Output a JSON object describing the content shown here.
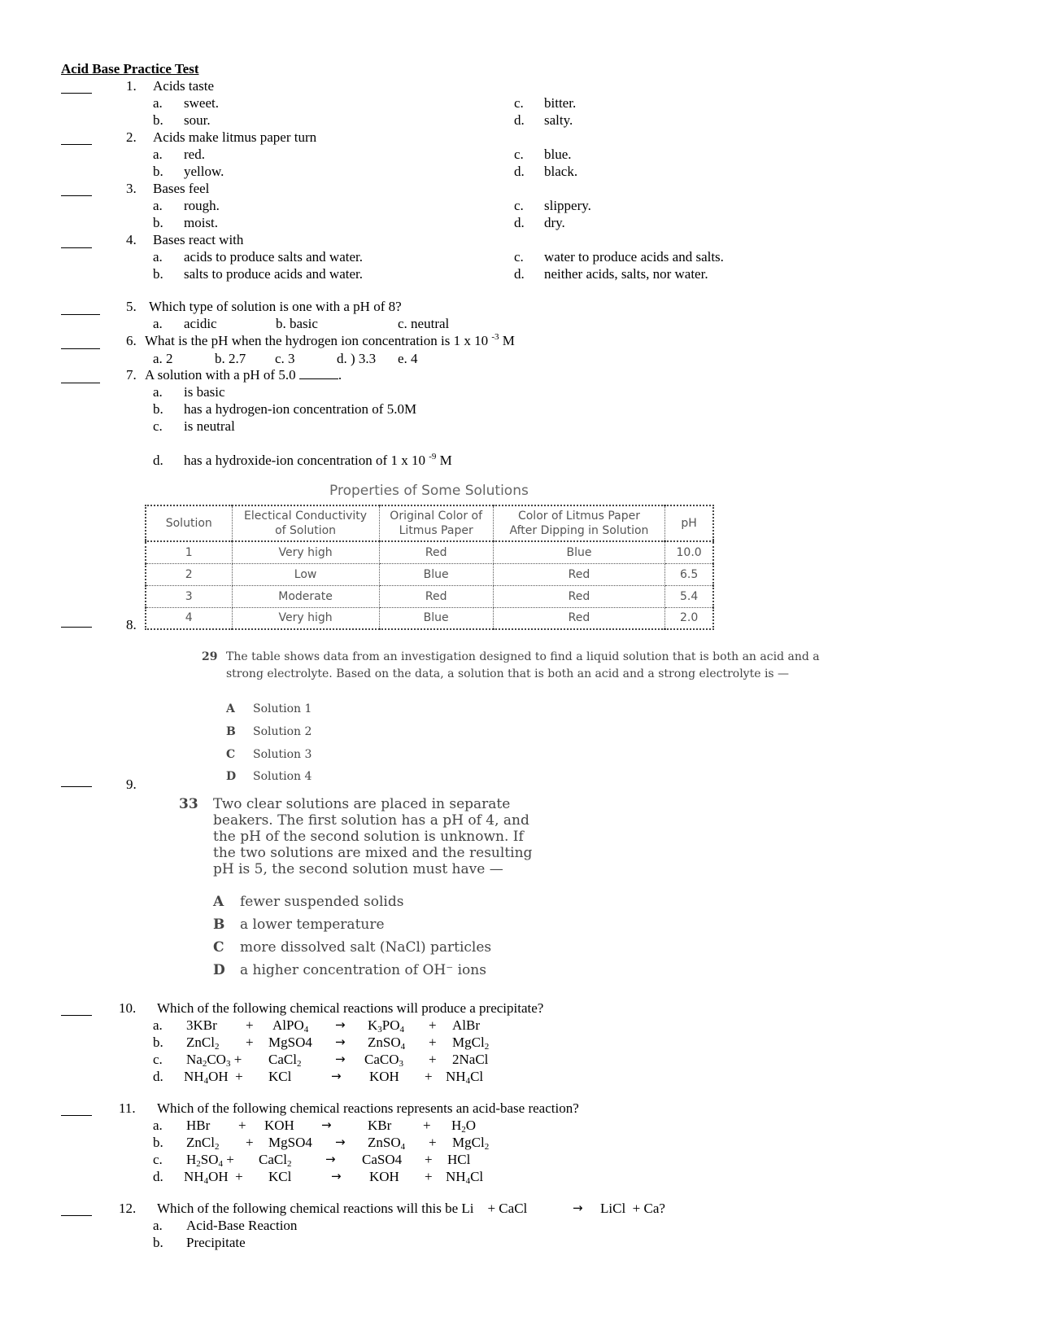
{
  "title": "Acid Base Practice Test",
  "q1": {
    "num": "1.",
    "text": "Acids taste",
    "a": "a.",
    "a_t": "sweet.",
    "b": "b.",
    "b_t": "sour.",
    "c": "c.",
    "c_t": "bitter.",
    "d": "d.",
    "d_t": "salty."
  },
  "q2": {
    "num": "2.",
    "text": "Acids make litmus paper turn",
    "a": "a.",
    "a_t": "red.",
    "b": "b.",
    "b_t": "yellow.",
    "c": "c.",
    "c_t": "blue.",
    "d": "d.",
    "d_t": "black."
  },
  "q3": {
    "num": "3.",
    "text": "Bases feel",
    "a": "a.",
    "a_t": "rough.",
    "b": "b.",
    "b_t": "moist.",
    "c": "c.",
    "c_t": "slippery.",
    "d": "d.",
    "d_t": "dry."
  },
  "q4": {
    "num": "4.",
    "text": "Bases react with",
    "a": "a.",
    "a_t": "acids to produce salts and water.",
    "b": "b.",
    "b_t": "salts to produce acids and water.",
    "c": "c.",
    "c_t": "water to produce acids and salts.",
    "d": "d.",
    "d_t": "neither acids, salts, nor water."
  },
  "q5": {
    "num": "5.",
    "text": "Which type of solution is one with a pH of 8?",
    "a": "a.",
    "a_t": "acidic",
    "b": "b.  basic",
    "c": "c.  neutral"
  },
  "q6": {
    "num": "6.",
    "text": "What is the pH when the hydrogen ion concentration is 1 x 10",
    "exp": "-3",
    "unit": " M",
    "options": [
      "a.  2",
      "b.  2.7",
      "c.  3",
      "d. ) 3.3",
      "e.  4"
    ]
  },
  "q7": {
    "num": "7.",
    "text": "A solution with a pH of 5.0",
    "end": ".",
    "a": "a.",
    "a_t": "is basic",
    "b": "b.",
    "b_t": "has a hydrogen-ion concentration of 5.0M",
    "c": "c.",
    "c_t": "is neutral",
    "d": "d.",
    "d_t": "has a hydroxide-ion concentration of 1 x 10",
    "d_exp": "-9",
    "d_unit": " M"
  },
  "q8": {
    "num": "8.",
    "figure_title": "Properties of Some Solutions",
    "headers": [
      "Solution",
      "Electrical Conductivity of Solution",
      "Original Color of Litmus Paper",
      "Color of Litmus Paper After Dipping in Solution",
      "pH"
    ],
    "headers_l1": [
      "Solution",
      "Electical Conductivity",
      "Original Color of",
      "Color of Litmus Paper",
      "pH"
    ],
    "headers_l2": [
      "",
      "of Solution",
      "Litmus Paper",
      "After Dipping in Solution",
      ""
    ],
    "rows": [
      [
        "1",
        "Very high",
        "Red",
        "Blue",
        "10.0"
      ],
      [
        "2",
        "Low",
        "Blue",
        "Red",
        "6.5"
      ],
      [
        "3",
        "Moderate",
        "Red",
        "Red",
        "5.4"
      ],
      [
        "4",
        "Very high",
        "Blue",
        "Red",
        "2.0"
      ]
    ],
    "sub_num": "29",
    "sub_text_1": "The table shows data from an investigation designed to find a liquid solution that is both an acid and a",
    "sub_text_2": "strong electrolyte. Based on the data, a solution that is both an acid and a strong electrolyte is —",
    "options": [
      {
        "letter": "A",
        "text": "Solution 1"
      },
      {
        "letter": "B",
        "text": "Solution 2"
      },
      {
        "letter": "C",
        "text": "Solution 3"
      },
      {
        "letter": "D",
        "text": "Solution 4"
      }
    ]
  },
  "q9": {
    "num": "9.",
    "sub_num": "33",
    "lines": [
      "Two clear solutions are placed in separate",
      "beakers. The first solution has a pH of 4, and",
      "the pH of the second solution is unknown. If",
      "the two solutions are mixed and the resulting",
      "pH is 5, the second solution must have —"
    ],
    "options": [
      {
        "letter": "A",
        "text": "fewer suspended solids"
      },
      {
        "letter": "B",
        "text": "a lower temperature"
      },
      {
        "letter": "C",
        "text": "more dissolved salt (NaCl) particles"
      },
      {
        "letter": "D",
        "text": "a higher concentration of OH⁻ ions"
      }
    ]
  },
  "q10": {
    "num": "10.",
    "text": "Which of the following chemical reactions will produce a precipitate?",
    "labels": [
      "a.",
      "b.",
      "c.",
      "d."
    ]
  },
  "q11": {
    "num": "11.",
    "text": "Which of the following chemical reactions represents an acid-base reaction?",
    "labels": [
      "a.",
      "b.",
      "c.",
      "d."
    ]
  },
  "q12": {
    "num": "12.",
    "text": "Which of the following chemical reactions will this be Li    + CaCl",
    "text_end": "LiCl  + Ca?",
    "a": "a.",
    "a_t": "Acid-Base Reaction",
    "b": "b.",
    "b_t": "Precipitate"
  },
  "symbols": {
    "plus": "+",
    "arrow": "→"
  }
}
